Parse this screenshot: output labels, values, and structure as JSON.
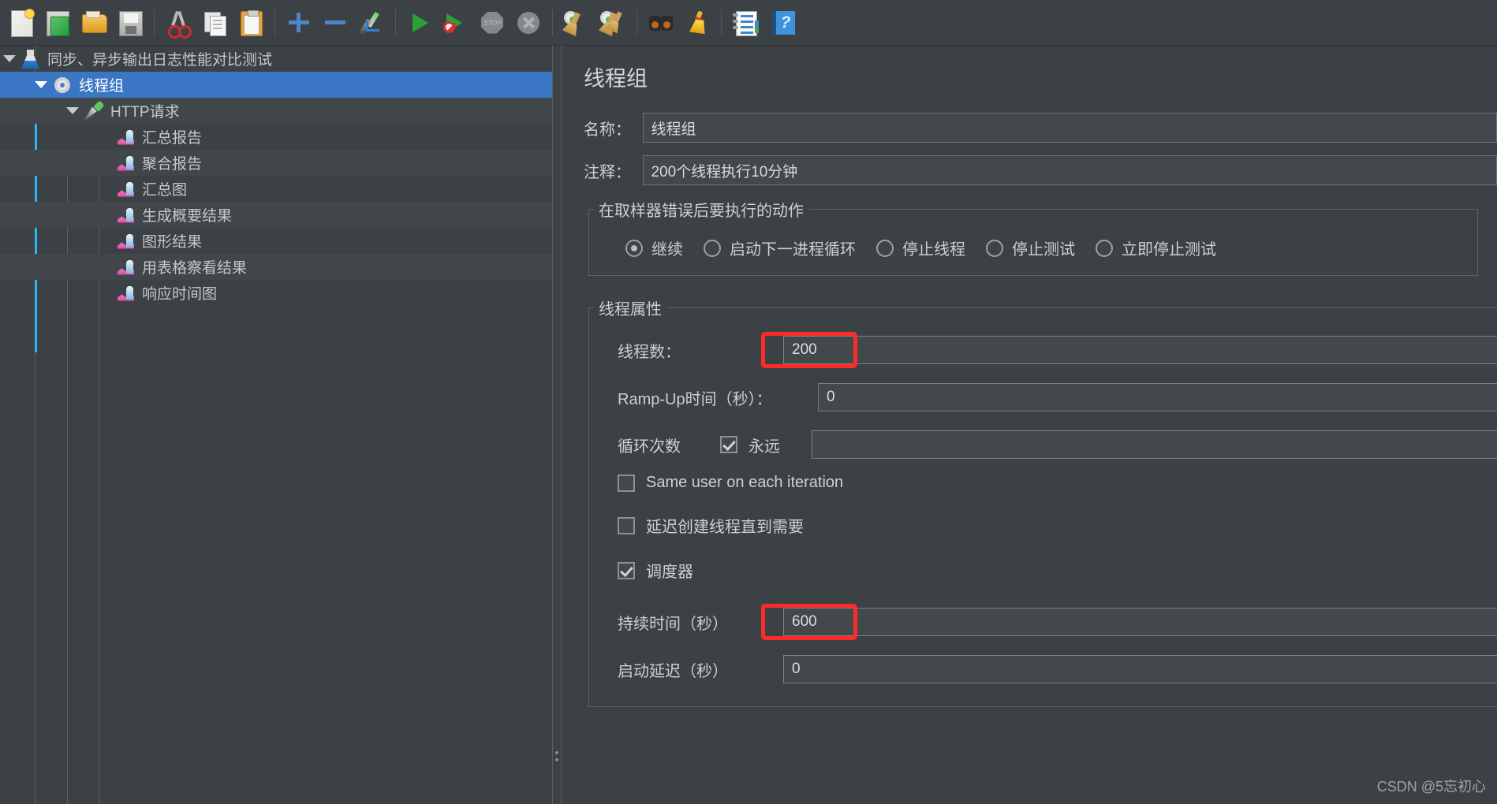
{
  "toolbar": {
    "groups": [
      {
        "buttons": [
          {
            "name": "new-button",
            "icon": "new-document-icon"
          },
          {
            "name": "templates-button",
            "icon": "templates-icon"
          },
          {
            "name": "open-button",
            "icon": "open-folder-icon"
          },
          {
            "name": "save-button",
            "icon": "save-disk-icon"
          }
        ]
      },
      {
        "buttons": [
          {
            "name": "cut-button",
            "icon": "scissors-icon"
          },
          {
            "name": "copy-button",
            "icon": "copy-icon"
          },
          {
            "name": "paste-button",
            "icon": "paste-clipboard-icon"
          }
        ]
      },
      {
        "buttons": [
          {
            "name": "expand-all-button",
            "icon": "plus-icon"
          },
          {
            "name": "collapse-all-button",
            "icon": "minus-icon"
          },
          {
            "name": "toggle-button",
            "icon": "pencil-toggle-icon"
          }
        ]
      },
      {
        "buttons": [
          {
            "name": "start-button",
            "icon": "play-icon"
          },
          {
            "name": "start-no-pauses-button",
            "icon": "play-no-pauses-icon"
          },
          {
            "name": "stop-button",
            "icon": "stop-sign-icon"
          },
          {
            "name": "shutdown-button",
            "icon": "shutdown-x-icon"
          }
        ]
      },
      {
        "buttons": [
          {
            "name": "clear-button",
            "icon": "gear-broom-icon"
          },
          {
            "name": "clear-all-button",
            "icon": "gear-brooms-icon"
          }
        ]
      },
      {
        "buttons": [
          {
            "name": "search-button",
            "icon": "binoculars-icon"
          },
          {
            "name": "reset-search-button",
            "icon": "yellow-broom-icon"
          }
        ]
      },
      {
        "buttons": [
          {
            "name": "log-viewer-button",
            "icon": "log-list-icon"
          },
          {
            "name": "help-button",
            "icon": "help-book-icon"
          }
        ]
      }
    ],
    "stop_glyph": "STOP",
    "help_glyph": "?"
  },
  "tree": {
    "items": [
      {
        "label": "同步、异步输出日志性能对比测试",
        "icon": "test-plan-flask-icon",
        "depth": 0,
        "twisty": true,
        "selected": false,
        "alt": false
      },
      {
        "label": "线程组",
        "icon": "thread-group-gear-icon",
        "depth": 1,
        "twisty": true,
        "selected": true,
        "alt": false
      },
      {
        "label": "HTTP请求",
        "icon": "http-request-pipette-icon",
        "depth": 2,
        "twisty": true,
        "selected": false,
        "alt": true
      },
      {
        "label": "汇总报告",
        "icon": "listener-chart-icon",
        "depth": 3,
        "twisty": false,
        "selected": false,
        "alt": false
      },
      {
        "label": "聚合报告",
        "icon": "listener-chart-icon",
        "depth": 3,
        "twisty": false,
        "selected": false,
        "alt": true
      },
      {
        "label": "汇总图",
        "icon": "listener-chart-icon",
        "depth": 3,
        "twisty": false,
        "selected": false,
        "alt": false
      },
      {
        "label": "生成概要结果",
        "icon": "listener-chart-icon",
        "depth": 3,
        "twisty": false,
        "selected": false,
        "alt": true
      },
      {
        "label": "图形结果",
        "icon": "listener-chart-icon",
        "depth": 3,
        "twisty": false,
        "selected": false,
        "alt": false
      },
      {
        "label": "用表格察看结果",
        "icon": "listener-chart-icon",
        "depth": 3,
        "twisty": false,
        "selected": false,
        "alt": true
      },
      {
        "label": "响应时间图",
        "icon": "listener-chart-icon",
        "depth": 3,
        "twisty": false,
        "selected": false,
        "alt": false
      }
    ]
  },
  "panel": {
    "title": "线程组",
    "name_label": "名称：",
    "name_value": "线程组",
    "comment_label": "注释：",
    "comment_value": "200个线程执行10分钟",
    "error_action": {
      "legend": "在取样器错误后要执行的动作",
      "options": [
        {
          "label": "继续",
          "selected": true
        },
        {
          "label": "启动下一进程循环",
          "selected": false
        },
        {
          "label": "停止线程",
          "selected": false
        },
        {
          "label": "停止测试",
          "selected": false
        },
        {
          "label": "立即停止测试",
          "selected": false
        }
      ]
    },
    "thread_properties": {
      "legend": "线程属性",
      "thread_count_label": "线程数：",
      "thread_count_value": "200",
      "ramp_up_label": "Ramp-Up时间（秒）：",
      "ramp_up_value": "0",
      "loop_count_label": "循环次数",
      "loop_forever_label": "永远",
      "loop_forever_checked": true,
      "loop_count_value": "",
      "same_user_label": "Same user on each iteration",
      "same_user_checked": false,
      "delay_thread_label": "延迟创建线程直到需要",
      "delay_thread_checked": false,
      "scheduler_label": "调度器",
      "scheduler_checked": true,
      "duration_label": "持续时间（秒）",
      "duration_value": "600",
      "startup_delay_label": "启动延迟（秒）",
      "startup_delay_value": "0"
    }
  },
  "watermark": "CSDN @5忘初心",
  "colors": {
    "selection_blue": "#3a76c4",
    "highlight_red": "#fc2a2a",
    "accent_cyan": "#29b6f6",
    "background": "#3c4145"
  }
}
